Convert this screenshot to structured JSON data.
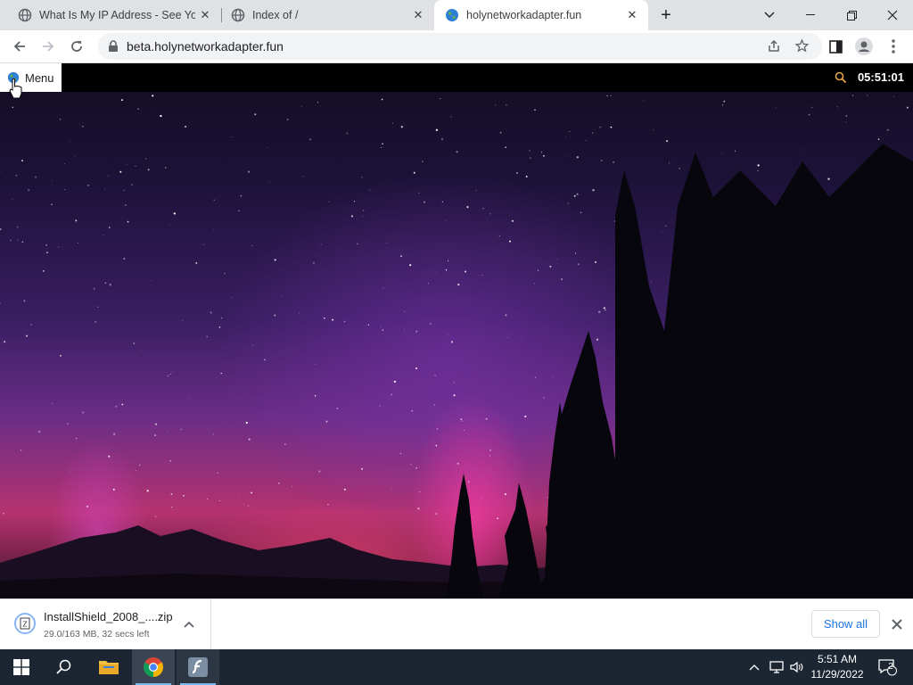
{
  "browser": {
    "tabs": [
      {
        "title": "What Is My IP Address - See Your",
        "active": false
      },
      {
        "title": "Index of /",
        "active": false
      },
      {
        "title": "holynetworkadapter.fun",
        "active": true
      }
    ],
    "address": "beta.holynetworkadapter.fun"
  },
  "page": {
    "menu_label": "Menu",
    "clock": "05:51:01"
  },
  "downloads": {
    "file_name": "InstallShield_2008_....zip",
    "status": "29.0/163 MB, 32 secs left",
    "show_all_label": "Show all"
  },
  "taskbar": {
    "time": "5:51 AM",
    "date": "11/29/2022",
    "notification_count": "2"
  },
  "colors": {
    "accent_blue": "#1a73e8",
    "taskbar": "#1c2633",
    "tab_strip": "#dfe1e5"
  }
}
